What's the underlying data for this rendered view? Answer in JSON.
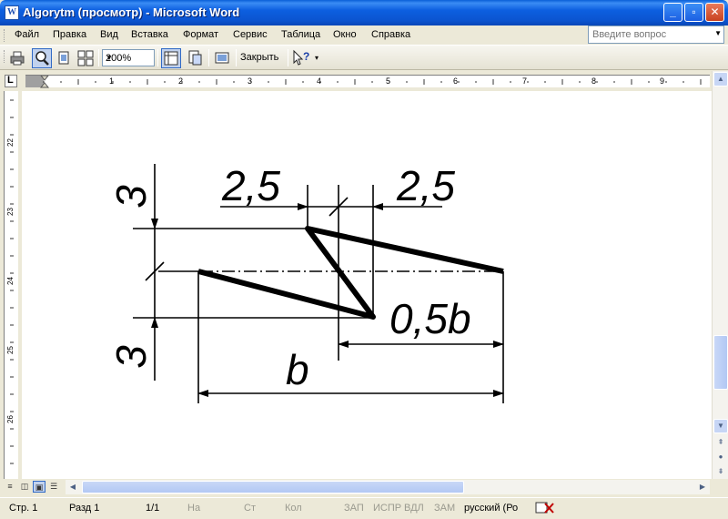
{
  "window": {
    "title": "Algorytm (просмотр) - Microsoft Word",
    "app_icon_letter": "W",
    "controls": {
      "minimize": "_",
      "maximize": "▫",
      "close": "✕"
    }
  },
  "menu": {
    "items": [
      "Файл",
      "Правка",
      "Вид",
      "Вставка",
      "Формат",
      "Сервис",
      "Таблица",
      "Окно",
      "Справка"
    ],
    "help_placeholder": "Введите вопрос"
  },
  "toolbar": {
    "zoom": "200%",
    "close_label": "Закрыть"
  },
  "hruler": {
    "labels": [
      "1",
      "2",
      "3",
      "4",
      "5",
      "6",
      "7",
      "8",
      "9"
    ]
  },
  "vruler": {
    "labels": [
      "22",
      "23",
      "24",
      "25",
      "26"
    ]
  },
  "drawing": {
    "dim_top_left": "3",
    "dim_bottom_left": "3",
    "dim_top_mid": "2,5",
    "dim_top_right": "2,5",
    "dim_half_b": "0,5b",
    "dim_b": "b"
  },
  "status": {
    "page": "Стр. 1",
    "section": "Разд 1",
    "pages": "1/1",
    "at": "На",
    "line": "Ст",
    "col": "Кол",
    "rec": "ЗАП",
    "trk": "ИСПР",
    "ext": "ВДЛ",
    "ovr": "ЗАМ",
    "language": "русский (Ро"
  },
  "colors": {
    "titlebar": "#0b54d0",
    "chrome": "#ece9d8",
    "page": "#ffffff"
  }
}
